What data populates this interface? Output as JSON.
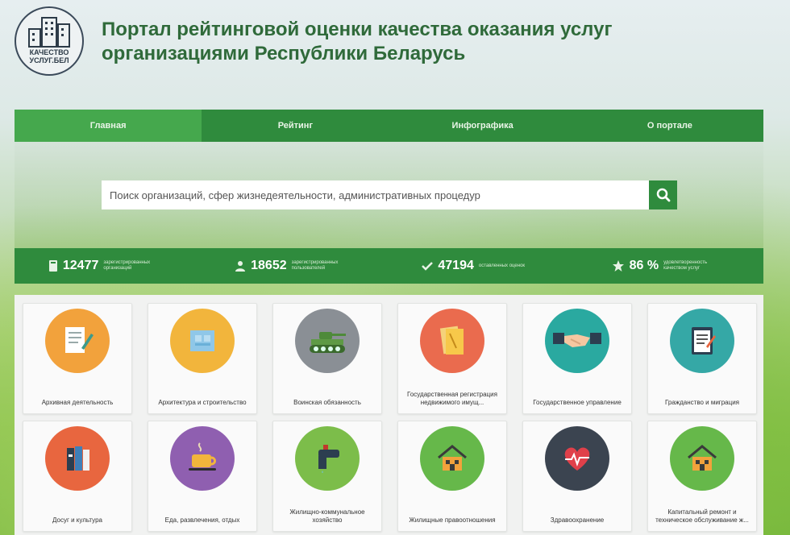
{
  "logo": {
    "line1": "КАЧЕСТВО",
    "line2": "УСЛУГ.БЕЛ"
  },
  "site_title": "Портал рейтинговой оценки качества оказания услуг организациями Республики Беларусь",
  "nav": [
    "Главная",
    "Рейтинг",
    "Инфографика",
    "О портале"
  ],
  "search": {
    "placeholder": "Поиск организаций, сфер жизнедеятельности, административных процедур"
  },
  "stats": [
    {
      "icon": "building-icon",
      "value": "12477",
      "label": "зарегистрированных организаций"
    },
    {
      "icon": "user-icon",
      "value": "18652",
      "label": "зарегистрированных пользователей"
    },
    {
      "icon": "check-icon",
      "value": "47194",
      "label": "оставленных оценок"
    },
    {
      "icon": "star-icon",
      "value": "86 %",
      "label": "удовлетворенность качеством услуг"
    }
  ],
  "categories": [
    {
      "label": "Архивная деятельность",
      "color": "#f2a23c",
      "icon": "archive-icon"
    },
    {
      "label": "Архитектура и строительство",
      "color": "#f2b53c",
      "icon": "architecture-icon"
    },
    {
      "label": "Воинская обязанность",
      "color": "#8a8f95",
      "icon": "tank-icon"
    },
    {
      "label": "Государственная регистрация недвижимого имущ...",
      "color": "#ea6b4e",
      "icon": "documents-icon"
    },
    {
      "label": "Государственное управление",
      "color": "#2aa9a0",
      "icon": "handshake-icon"
    },
    {
      "label": "Гражданство и миграция",
      "color": "#35a8a6",
      "icon": "clipboard-icon"
    },
    {
      "label": "Досуг и культура",
      "color": "#e8663f",
      "icon": "books-icon"
    },
    {
      "label": "Еда, развлечения, отдых",
      "color": "#8f5fb0",
      "icon": "coffee-icon"
    },
    {
      "label": "Жилищно-коммунальное хозяйство",
      "color": "#7cbd4a",
      "icon": "faucet-icon"
    },
    {
      "label": "Жилищные правоотношения",
      "color": "#66b84a",
      "icon": "house-icon"
    },
    {
      "label": "Здравоохранение",
      "color": "#3b4450",
      "icon": "heart-icon"
    },
    {
      "label": "Капитальный ремонт и техническое обслуживание ж...",
      "color": "#66b84a",
      "icon": "house-icon"
    }
  ]
}
